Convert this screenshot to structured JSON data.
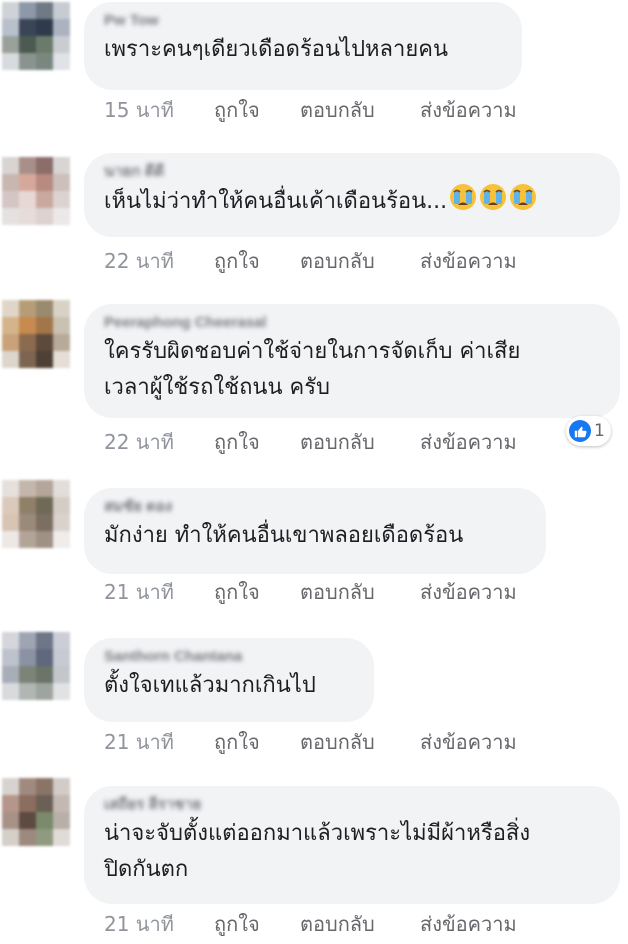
{
  "comments": [
    {
      "author": "Pw Tow",
      "text": "เพราะคนๆเดียวเดือดร้อนไปหลายคน",
      "time": "15 นาที",
      "avatar_colors": [
        "#cfd3d8",
        "#8d98a8",
        "#6f7a86",
        "#c7ccd2",
        "#b8c0cb",
        "#3a4658",
        "#2f3b4d",
        "#aab3bf",
        "#9aa19a",
        "#4c5a52",
        "#6b7b6a",
        "#c9cdd2",
        "#d7dadf",
        "#8a948f",
        "#7a8780",
        "#dfe2e6"
      ]
    },
    {
      "author": "นายก ดีดี",
      "text": "เห็นไม่ว่าทำให้คนอื่นเค้าเดือนร้อน...",
      "emoji_count": 3,
      "time": "22 นาที",
      "avatar_colors": [
        "#d9d4d2",
        "#a98f8a",
        "#8b6e6a",
        "#d8d5d4",
        "#c9b6b0",
        "#d6a89b",
        "#b88a80",
        "#cdbfbb",
        "#d4c6c4",
        "#e8d8d3",
        "#c9a99f",
        "#dcd3d1",
        "#e5e1e0",
        "#e6dcd9",
        "#ddd2cf",
        "#ebe8e7"
      ]
    },
    {
      "author": "Peeraphong Cheerasal",
      "text": "ใครรับผิดชอบค่าใช้จ่ายในการจัดเก็บ ค่าเสีย\nเวลาผู้ใช้รถใช้ถนน ครับ",
      "time": "22 นาที",
      "reaction_count": "1",
      "avatar_colors": [
        "#e0d6c7",
        "#b69d78",
        "#9a8a6e",
        "#d8d2c6",
        "#d4b48a",
        "#c88a4e",
        "#a3764a",
        "#c9c1b2",
        "#caa27a",
        "#8b6a4d",
        "#5d4a3a",
        "#b8aa98",
        "#ddd6cc",
        "#7d6552",
        "#4e4035",
        "#e4ded6"
      ]
    },
    {
      "author": "สมชัย ดอง",
      "text": "มักง่าย ทำให้คนอื่นเขาพลอยเดือดร้อน",
      "time": "21 นาที",
      "avatar_colors": [
        "#e5e0dc",
        "#c4b6ac",
        "#b4a69a",
        "#e2ddd9",
        "#dbc9bc",
        "#8f8068",
        "#6f6a55",
        "#d5cdc5",
        "#d8c4b3",
        "#9a8a7a",
        "#7d6e62",
        "#d9d2cc",
        "#ece8e5",
        "#b3a498",
        "#9f9185",
        "#efece9"
      ]
    },
    {
      "author": "Santhorn Chantana",
      "text": "ตั้งใจเทแล้วมากเกินไป",
      "time": "21 นาที",
      "avatar_colors": [
        "#d4d6dc",
        "#9fa4b2",
        "#6e7689",
        "#cbced6",
        "#bdc2cc",
        "#8b92a4",
        "#5f687c",
        "#c6cad2",
        "#a8aeb8",
        "#7c8478",
        "#6b7468",
        "#c3c7cc",
        "#d8dadd",
        "#b1b6b2",
        "#9ea49f",
        "#e0e2e4"
      ]
    },
    {
      "author": "เสถียร ลีราชาย",
      "text": "น่าจะจับตั้งแต่ออกมาแล้วเพราะไม่มีผ้าหรือสิ่ง\nปิดกันตก",
      "time": "21 นาที",
      "avatar_colors": [
        "#d8d3d0",
        "#a08a80",
        "#8a7468",
        "#d2ccc8",
        "#b5968a",
        "#8b6e60",
        "#6a6055",
        "#c4b9b2",
        "#a89288",
        "#5d4a40",
        "#7a8a6a",
        "#b8b0a8",
        "#d5cfca",
        "#9c8a7e",
        "#8f9a80",
        "#e0dbd7"
      ]
    }
  ],
  "actions": {
    "like": "ถูกใจ",
    "reply": "ตอบกลับ",
    "message": "ส่งข้อความ"
  },
  "colors": {
    "bubble": "#f2f3f5",
    "link": "#65676b",
    "timestamp": "#90949c",
    "like_blue": "#1877f2"
  }
}
